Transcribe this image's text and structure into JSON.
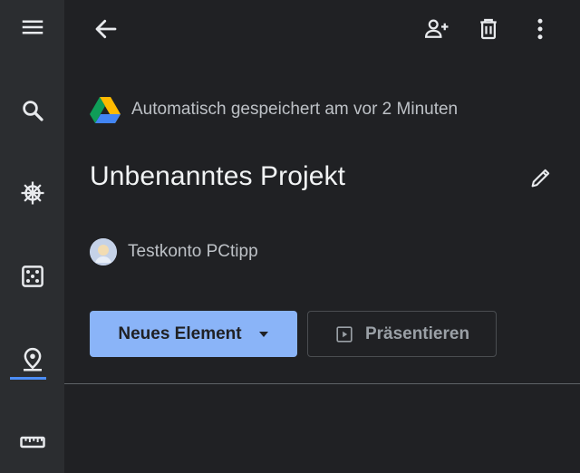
{
  "rail": {
    "items": [
      {
        "name": "menu-icon"
      },
      {
        "name": "search-icon"
      },
      {
        "name": "ship-wheel-icon"
      },
      {
        "name": "dice-icon"
      },
      {
        "name": "map-pin-icon"
      },
      {
        "name": "ruler-icon"
      }
    ],
    "active": "map-pin-icon",
    "accent": "#4c8df6"
  },
  "header": {
    "back": "arrow-back-icon",
    "actions": [
      "add-person-icon",
      "trash-icon",
      "more-vert-icon"
    ]
  },
  "project": {
    "saved_status": "Automatisch gespeichert am vor 2 Minuten",
    "title": "Unbenanntes Projekt",
    "owner": "Testkonto PCtipp"
  },
  "buttons": {
    "new_element": "Neues Element",
    "present": "Präsentieren"
  },
  "colors": {
    "background": "#202124",
    "rail": "#2b2d30",
    "primary_button": "#8ab4f8"
  }
}
